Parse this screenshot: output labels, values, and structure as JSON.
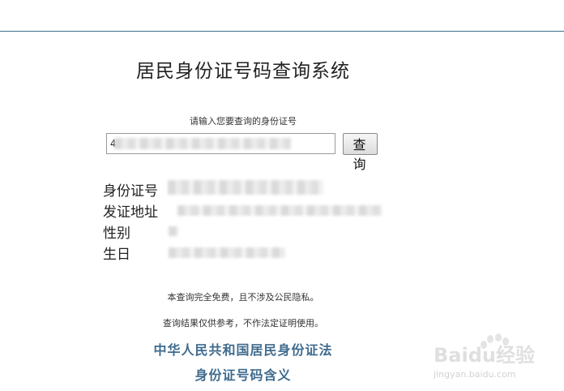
{
  "page": {
    "title": "居民身份证号码查询系统"
  },
  "search": {
    "prompt": "请输入您要查询的身份证号",
    "input_value": "4",
    "button_label": "查 询"
  },
  "results": [
    {
      "label": "身份证号"
    },
    {
      "label": "发证地址"
    },
    {
      "label": "性别"
    },
    {
      "label": "生日"
    }
  ],
  "footer": {
    "notes": [
      "本查询完全免费，且不涉及公民隐私。",
      "查询结果仅供参考，不作法定证明使用。"
    ],
    "links": [
      "中华人民共和国居民身份证法",
      "身份证号码含义"
    ]
  },
  "watermark": {
    "brand": "Baidu经验",
    "url": "jingyan.baidu.com"
  },
  "colors": {
    "rule": "#3c6f8a",
    "link": "#3f6b8e"
  }
}
